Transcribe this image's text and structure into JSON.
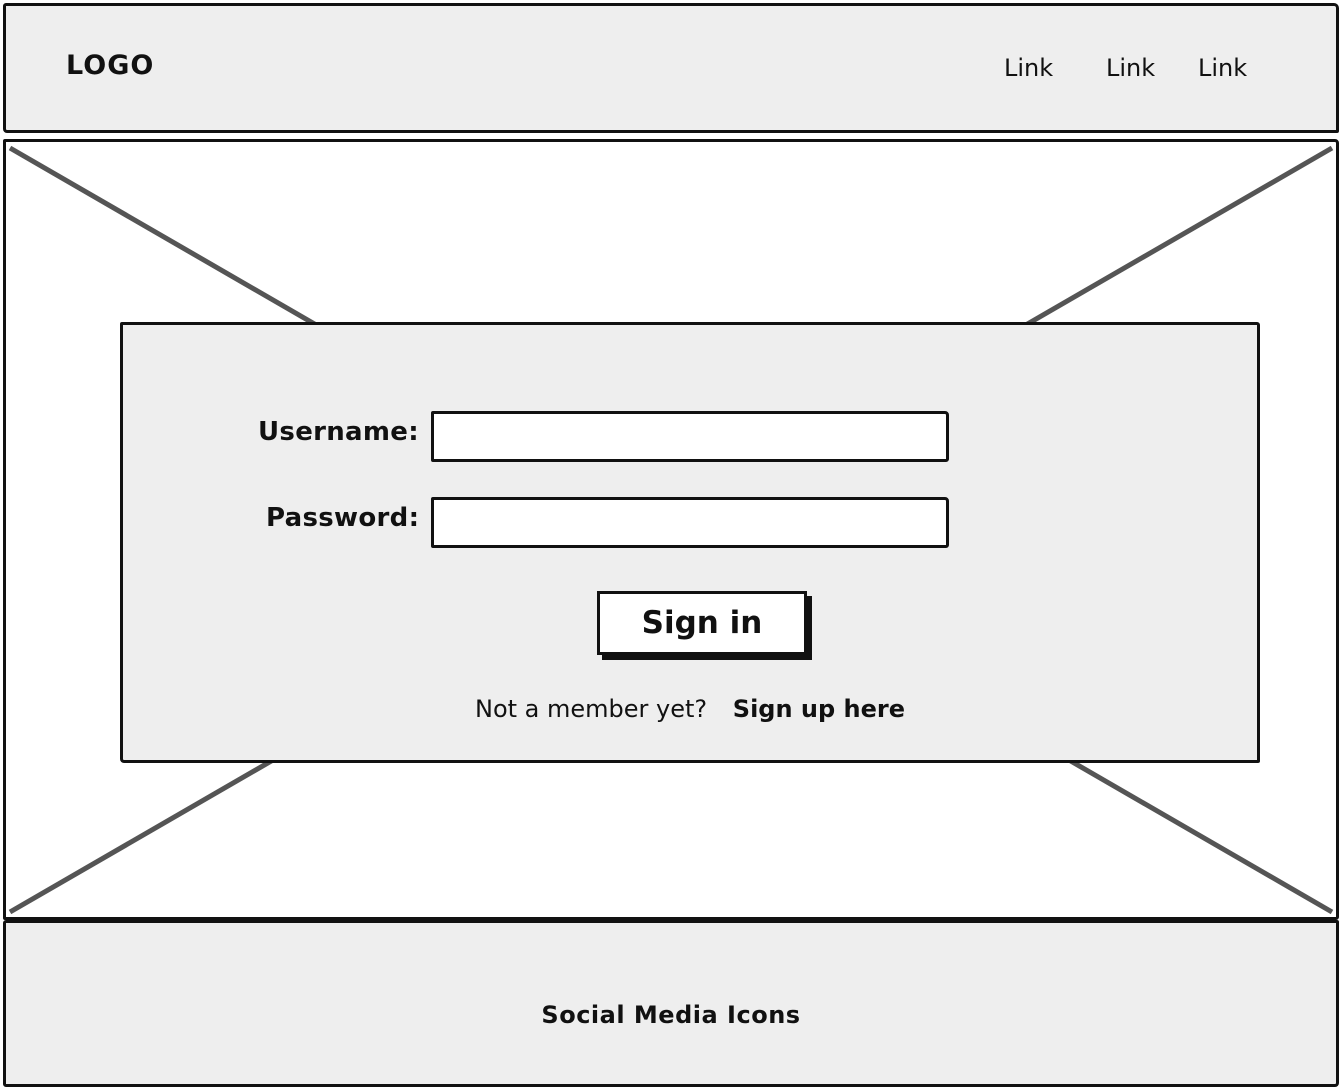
{
  "header": {
    "logo_text": "LOGO",
    "nav_links": [
      "Link",
      "Link",
      "Link"
    ]
  },
  "login": {
    "username_label": "Username:",
    "username_value": "",
    "password_label": "Password:",
    "password_value": "",
    "signin_label": "Sign in",
    "signup_prompt": "Not a member yet?",
    "signup_link": "Sign up here"
  },
  "footer": {
    "social_text": "Social Media Icons"
  },
  "colors": {
    "panel_background": "#eeeeee",
    "border": "#111111",
    "placeholder_cross": "#555555"
  },
  "icons": {
    "hero": "image-placeholder-icon"
  }
}
